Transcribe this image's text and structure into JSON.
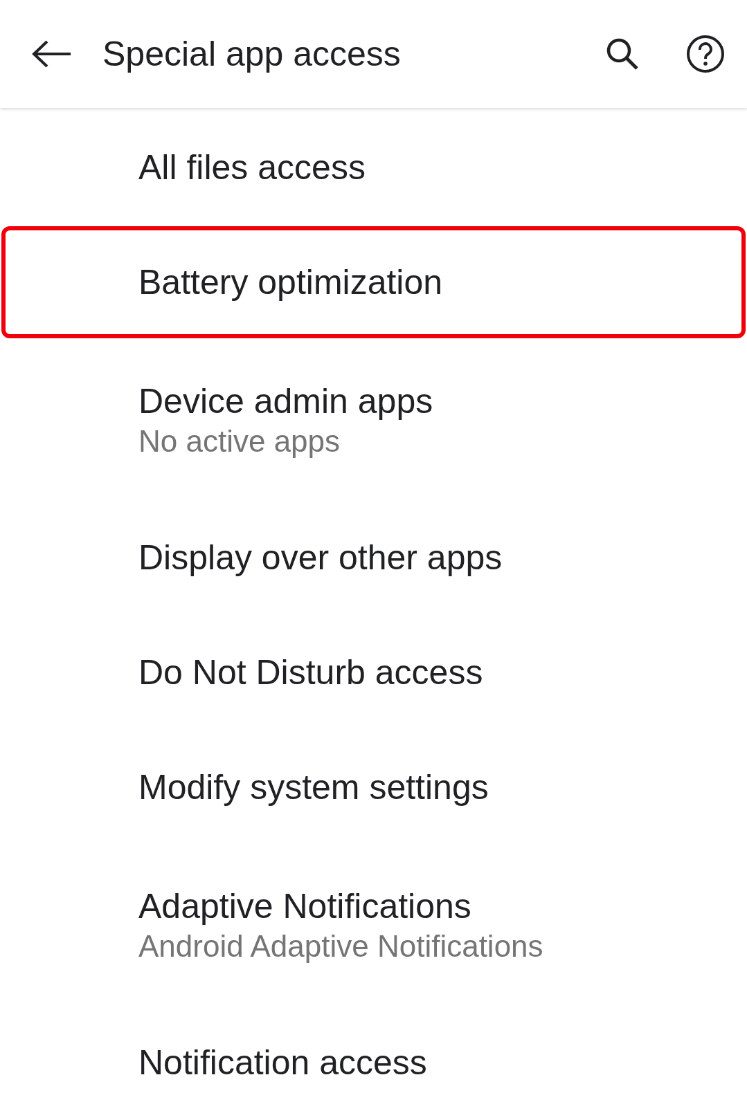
{
  "app_bar": {
    "title": "Special app access"
  },
  "items": [
    {
      "title": "All files access",
      "highlighted": false
    },
    {
      "title": "Battery optimization",
      "highlighted": true
    },
    {
      "title": "Device admin apps",
      "summary": "No active apps",
      "highlighted": false
    },
    {
      "title": "Display over other apps",
      "highlighted": false
    },
    {
      "title": "Do Not Disturb access",
      "highlighted": false
    },
    {
      "title": "Modify system settings",
      "highlighted": false
    },
    {
      "title": "Adaptive Notifications",
      "summary": "Android Adaptive Notifications",
      "highlighted": false
    },
    {
      "title": "Notification access",
      "highlighted": false
    }
  ]
}
